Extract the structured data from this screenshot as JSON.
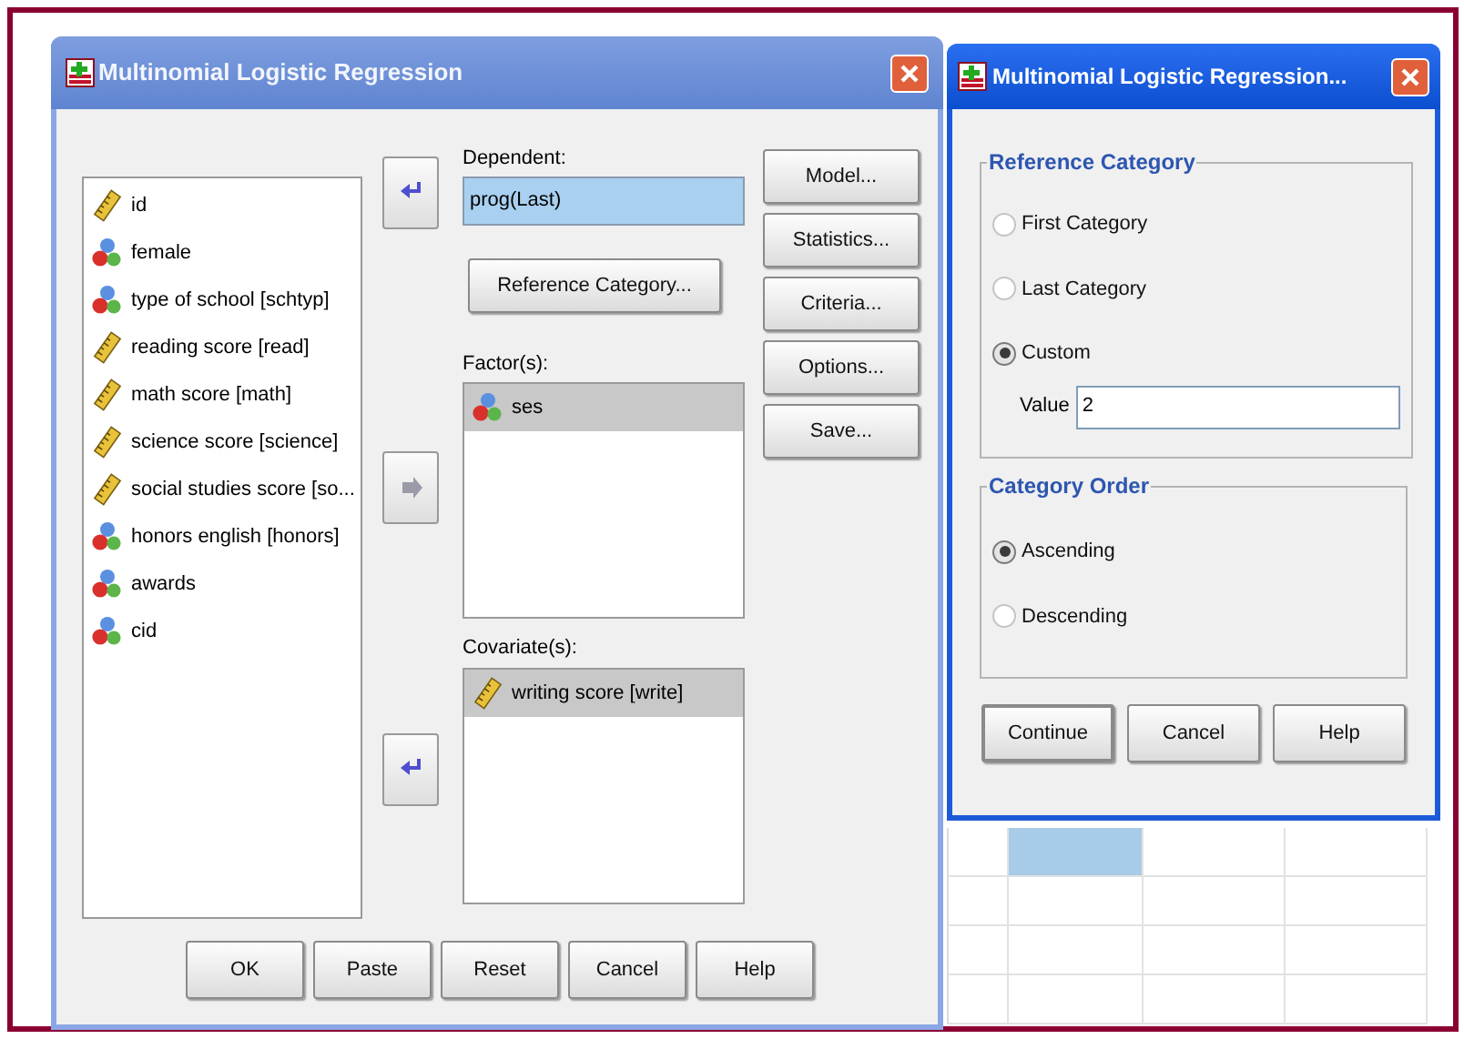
{
  "main_dialog": {
    "title": "Multinomial Logistic Regression",
    "variables": [
      {
        "name": "id",
        "kind": "scale",
        "selected": false
      },
      {
        "name": "female",
        "kind": "nominal",
        "selected": false
      },
      {
        "name": "type of school [schtyp]",
        "kind": "nominal",
        "selected": false
      },
      {
        "name": "reading score [read]",
        "kind": "scale",
        "selected": false
      },
      {
        "name": "math score [math]",
        "kind": "scale",
        "selected": false
      },
      {
        "name": "science score [science]",
        "kind": "scale",
        "selected": false
      },
      {
        "name": "social studies score [so...",
        "kind": "scale",
        "selected": false
      },
      {
        "name": "honors english [honors]",
        "kind": "nominal",
        "selected": false
      },
      {
        "name": "awards",
        "kind": "nominal",
        "selected": false
      },
      {
        "name": "cid",
        "kind": "nominal",
        "selected": false
      }
    ],
    "arrow_buttons": [
      {
        "disabled": false
      },
      {
        "disabled": true
      },
      {
        "disabled": false
      }
    ],
    "dependent": {
      "label": "Dependent:",
      "value": "prog(Last)"
    },
    "reference_category_button": "Reference Category...",
    "factors": {
      "label": "Factor(s):",
      "items": [
        {
          "name": "ses",
          "kind": "nominal",
          "selected": true
        }
      ]
    },
    "covariates": {
      "label": "Covariate(s):",
      "items": [
        {
          "name": "writing score [write]",
          "kind": "scale",
          "selected": true
        }
      ]
    },
    "side_buttons": [
      "Model...",
      "Statistics...",
      "Criteria...",
      "Options...",
      "Save..."
    ],
    "bottom_buttons": [
      "OK",
      "Paste",
      "Reset",
      "Cancel",
      "Help"
    ]
  },
  "sub_dialog": {
    "title": "Multinomial Logistic Regression...",
    "reference_category": {
      "legend": "Reference Category",
      "options": [
        {
          "label": "First Category",
          "selected": false
        },
        {
          "label": "Last Category",
          "selected": false
        },
        {
          "label": "Custom",
          "selected": true
        }
      ],
      "value_label": "Value",
      "value": "2"
    },
    "category_order": {
      "legend": "Category Order",
      "options": [
        {
          "label": "Ascending",
          "selected": true
        },
        {
          "label": "Descending",
          "selected": false
        }
      ]
    },
    "buttons": [
      "Continue",
      "Cancel",
      "Help"
    ]
  }
}
